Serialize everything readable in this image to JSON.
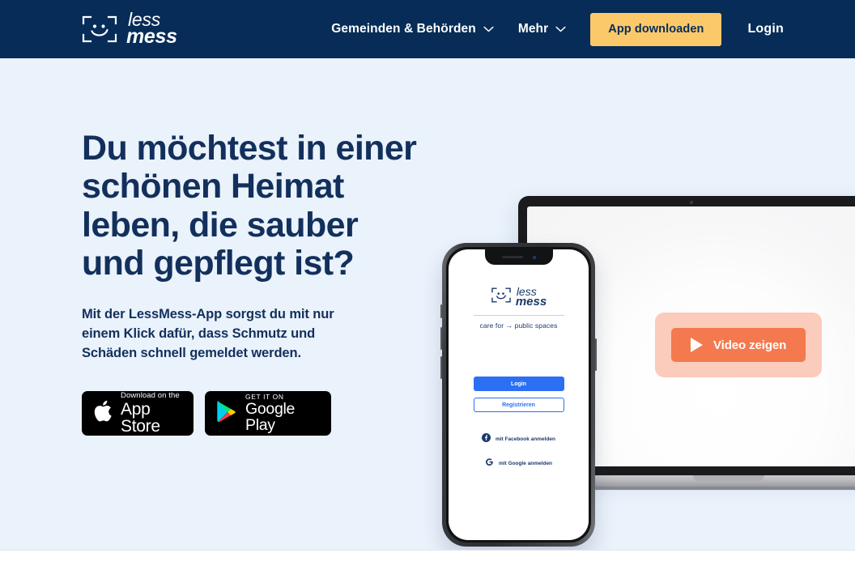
{
  "brand": {
    "name_line1": "less",
    "name_line2": "mess",
    "logo_icon": "scan-smiley-logo-icon",
    "navy": "#062C57",
    "heading_navy": "#13305C",
    "hero_bg": "#EAF2FC",
    "accent_yellow": "#FBC96A",
    "accent_orange": "#F4794F",
    "accent_orange_soft": "#FBCBBB",
    "phone_blue": "#2B6FF5"
  },
  "header": {
    "nav_items": [
      {
        "label": "Gemeinden & Behörden",
        "has_dropdown": true,
        "icon": "chevron-down-icon"
      },
      {
        "label": "Mehr",
        "has_dropdown": true,
        "icon": "chevron-down-icon"
      }
    ],
    "cta_label": "App downloaden",
    "login_label": "Login"
  },
  "hero": {
    "title": "Du möchtest in einer schönen Heimat leben, die sauber und gepflegt ist?",
    "subtitle": "Mit der LessMess-App sorgst du mit nur einem Klick dafür, dass Schmutz und Schäden schnell gemeldet werden.",
    "badges": [
      {
        "store": "apple-app-store-badge",
        "icon": "apple-icon",
        "small_text": "Download on the",
        "big_text": "App Store"
      },
      {
        "store": "google-play-badge",
        "icon": "google-play-icon",
        "small_text": "GET IT ON",
        "big_text": "Google Play"
      }
    ],
    "video_button": {
      "label": "Video zeigen",
      "icon": "play-icon"
    }
  },
  "phone_mockup": {
    "device": "smartphone-mockup",
    "app_logo_line1": "less",
    "app_logo_line2": "mess",
    "tagline": "care for → public spaces",
    "primary_button": "Login",
    "secondary_button": "Registrieren",
    "social_logins": [
      {
        "label": "mit Facebook anmelden",
        "icon": "facebook-icon"
      },
      {
        "label": "mit Google anmelden",
        "icon": "google-icon"
      }
    ]
  },
  "laptop_mockup": {
    "device": "laptop-mockup"
  }
}
